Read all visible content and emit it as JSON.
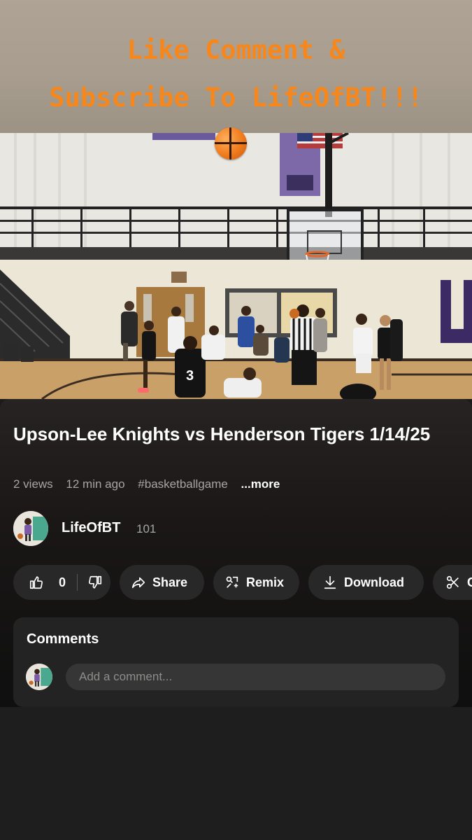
{
  "banner": {
    "line1": "Like Comment &",
    "line2": "Subscribe To LifeOfBT!!!"
  },
  "video": {
    "player_number": "3"
  },
  "title": "Upson-Lee Knights vs Henderson Tigers 1/14/25",
  "meta": {
    "views": "2 views",
    "time": "12 min ago",
    "hashtag": "#basketballgame",
    "more": "...more"
  },
  "channel": {
    "name": "LifeOfBT",
    "subscribers": "101"
  },
  "actions": {
    "like_count": "0",
    "share": "Share",
    "remix": "Remix",
    "download": "Download",
    "clip": "C"
  },
  "comments": {
    "title": "Comments",
    "placeholder": "Add a comment..."
  },
  "colors": {
    "banner_text": "#f7871a",
    "banner_bg": "#a89d8e",
    "pill_bg": "#282828"
  }
}
